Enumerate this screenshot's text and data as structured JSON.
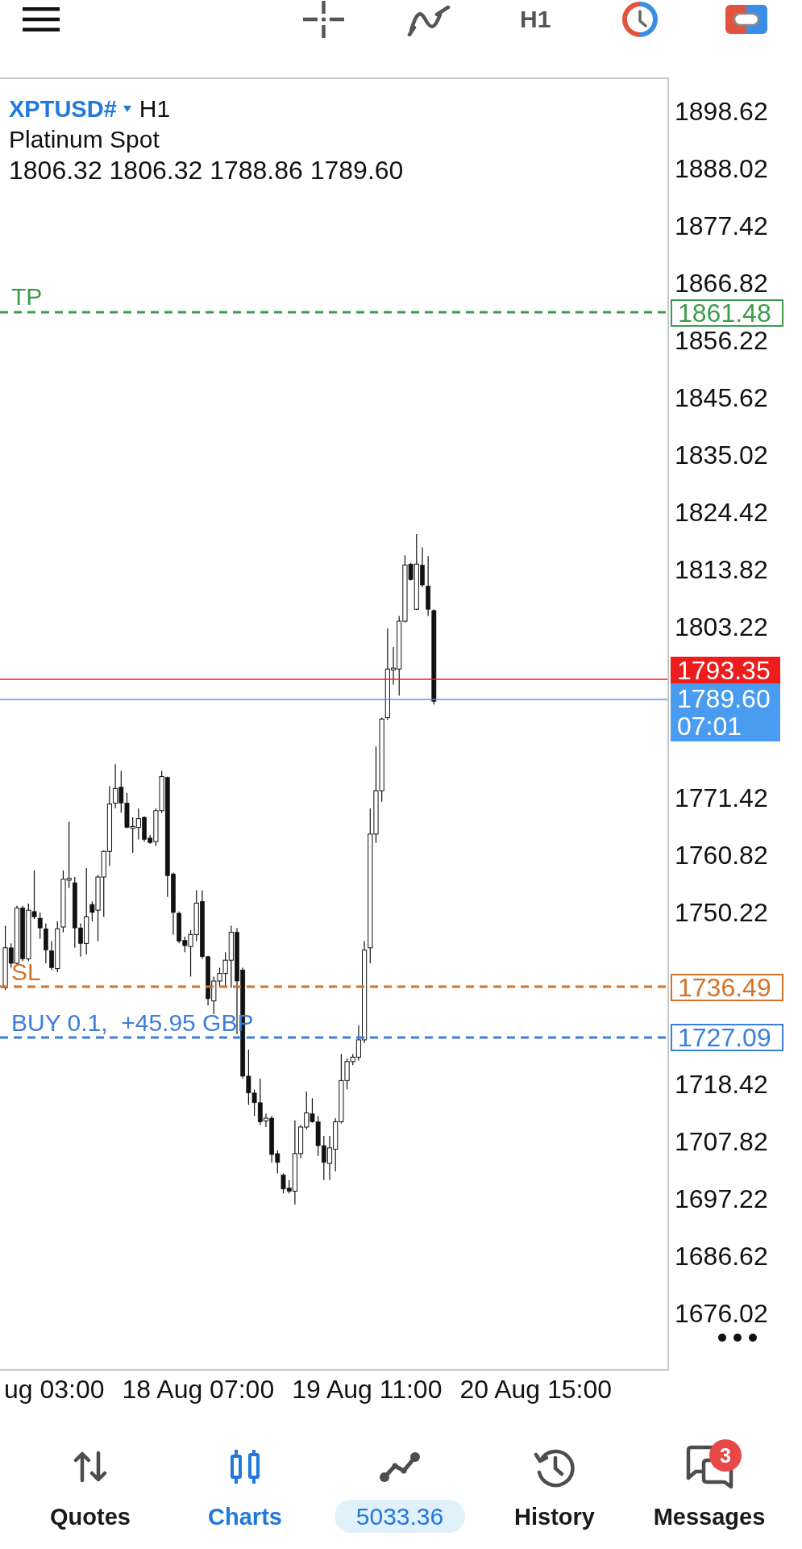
{
  "toolbar": {
    "timeframe": "H1"
  },
  "chart": {
    "symbol": "XPTUSD#",
    "timeframe": "H1",
    "description": "Platinum Spot",
    "ohlc": "1806.32 1806.32 1788.86 1789.60",
    "levels": [
      {
        "kind": "take_profit",
        "label": "TP",
        "price": "1861.48",
        "color": "#3d9b4c"
      },
      {
        "kind": "bid",
        "price": "1793.35",
        "color": "#ee1c1c"
      },
      {
        "kind": "last",
        "price": "1789.60",
        "time": "07:01",
        "color": "#4a9cf0"
      },
      {
        "kind": "stop_loss",
        "label": "SL",
        "price": "1736.49",
        "color": "#d2732a"
      },
      {
        "kind": "position",
        "label": "BUY 0.1,  +45.95 GBP",
        "price": "1727.09",
        "color": "#3a7fd9"
      }
    ],
    "price_axis": [
      "1898.62",
      "1888.02",
      "1877.42",
      "1866.82",
      "1856.22",
      "1845.62",
      "1835.02",
      "1824.42",
      "1813.82",
      "1803.22",
      "1771.42",
      "1760.82",
      "1750.22",
      "1718.42",
      "1707.82",
      "1697.22",
      "1686.62",
      "1676.02"
    ],
    "time_axis": [
      "ug 03:00",
      "18 Aug 07:00",
      "19 Aug 11:00",
      "20 Aug 15:00"
    ]
  },
  "bottom_nav": [
    {
      "kind": "tab",
      "label": "Quotes",
      "selected": false
    },
    {
      "kind": "tab",
      "label": "Charts",
      "selected": true
    },
    {
      "kind": "balance",
      "label": "5033.36",
      "selected": false
    },
    {
      "kind": "tab",
      "label": "History",
      "selected": false
    },
    {
      "kind": "tab",
      "label": "Messages",
      "selected": false,
      "badge": "3"
    }
  ]
}
